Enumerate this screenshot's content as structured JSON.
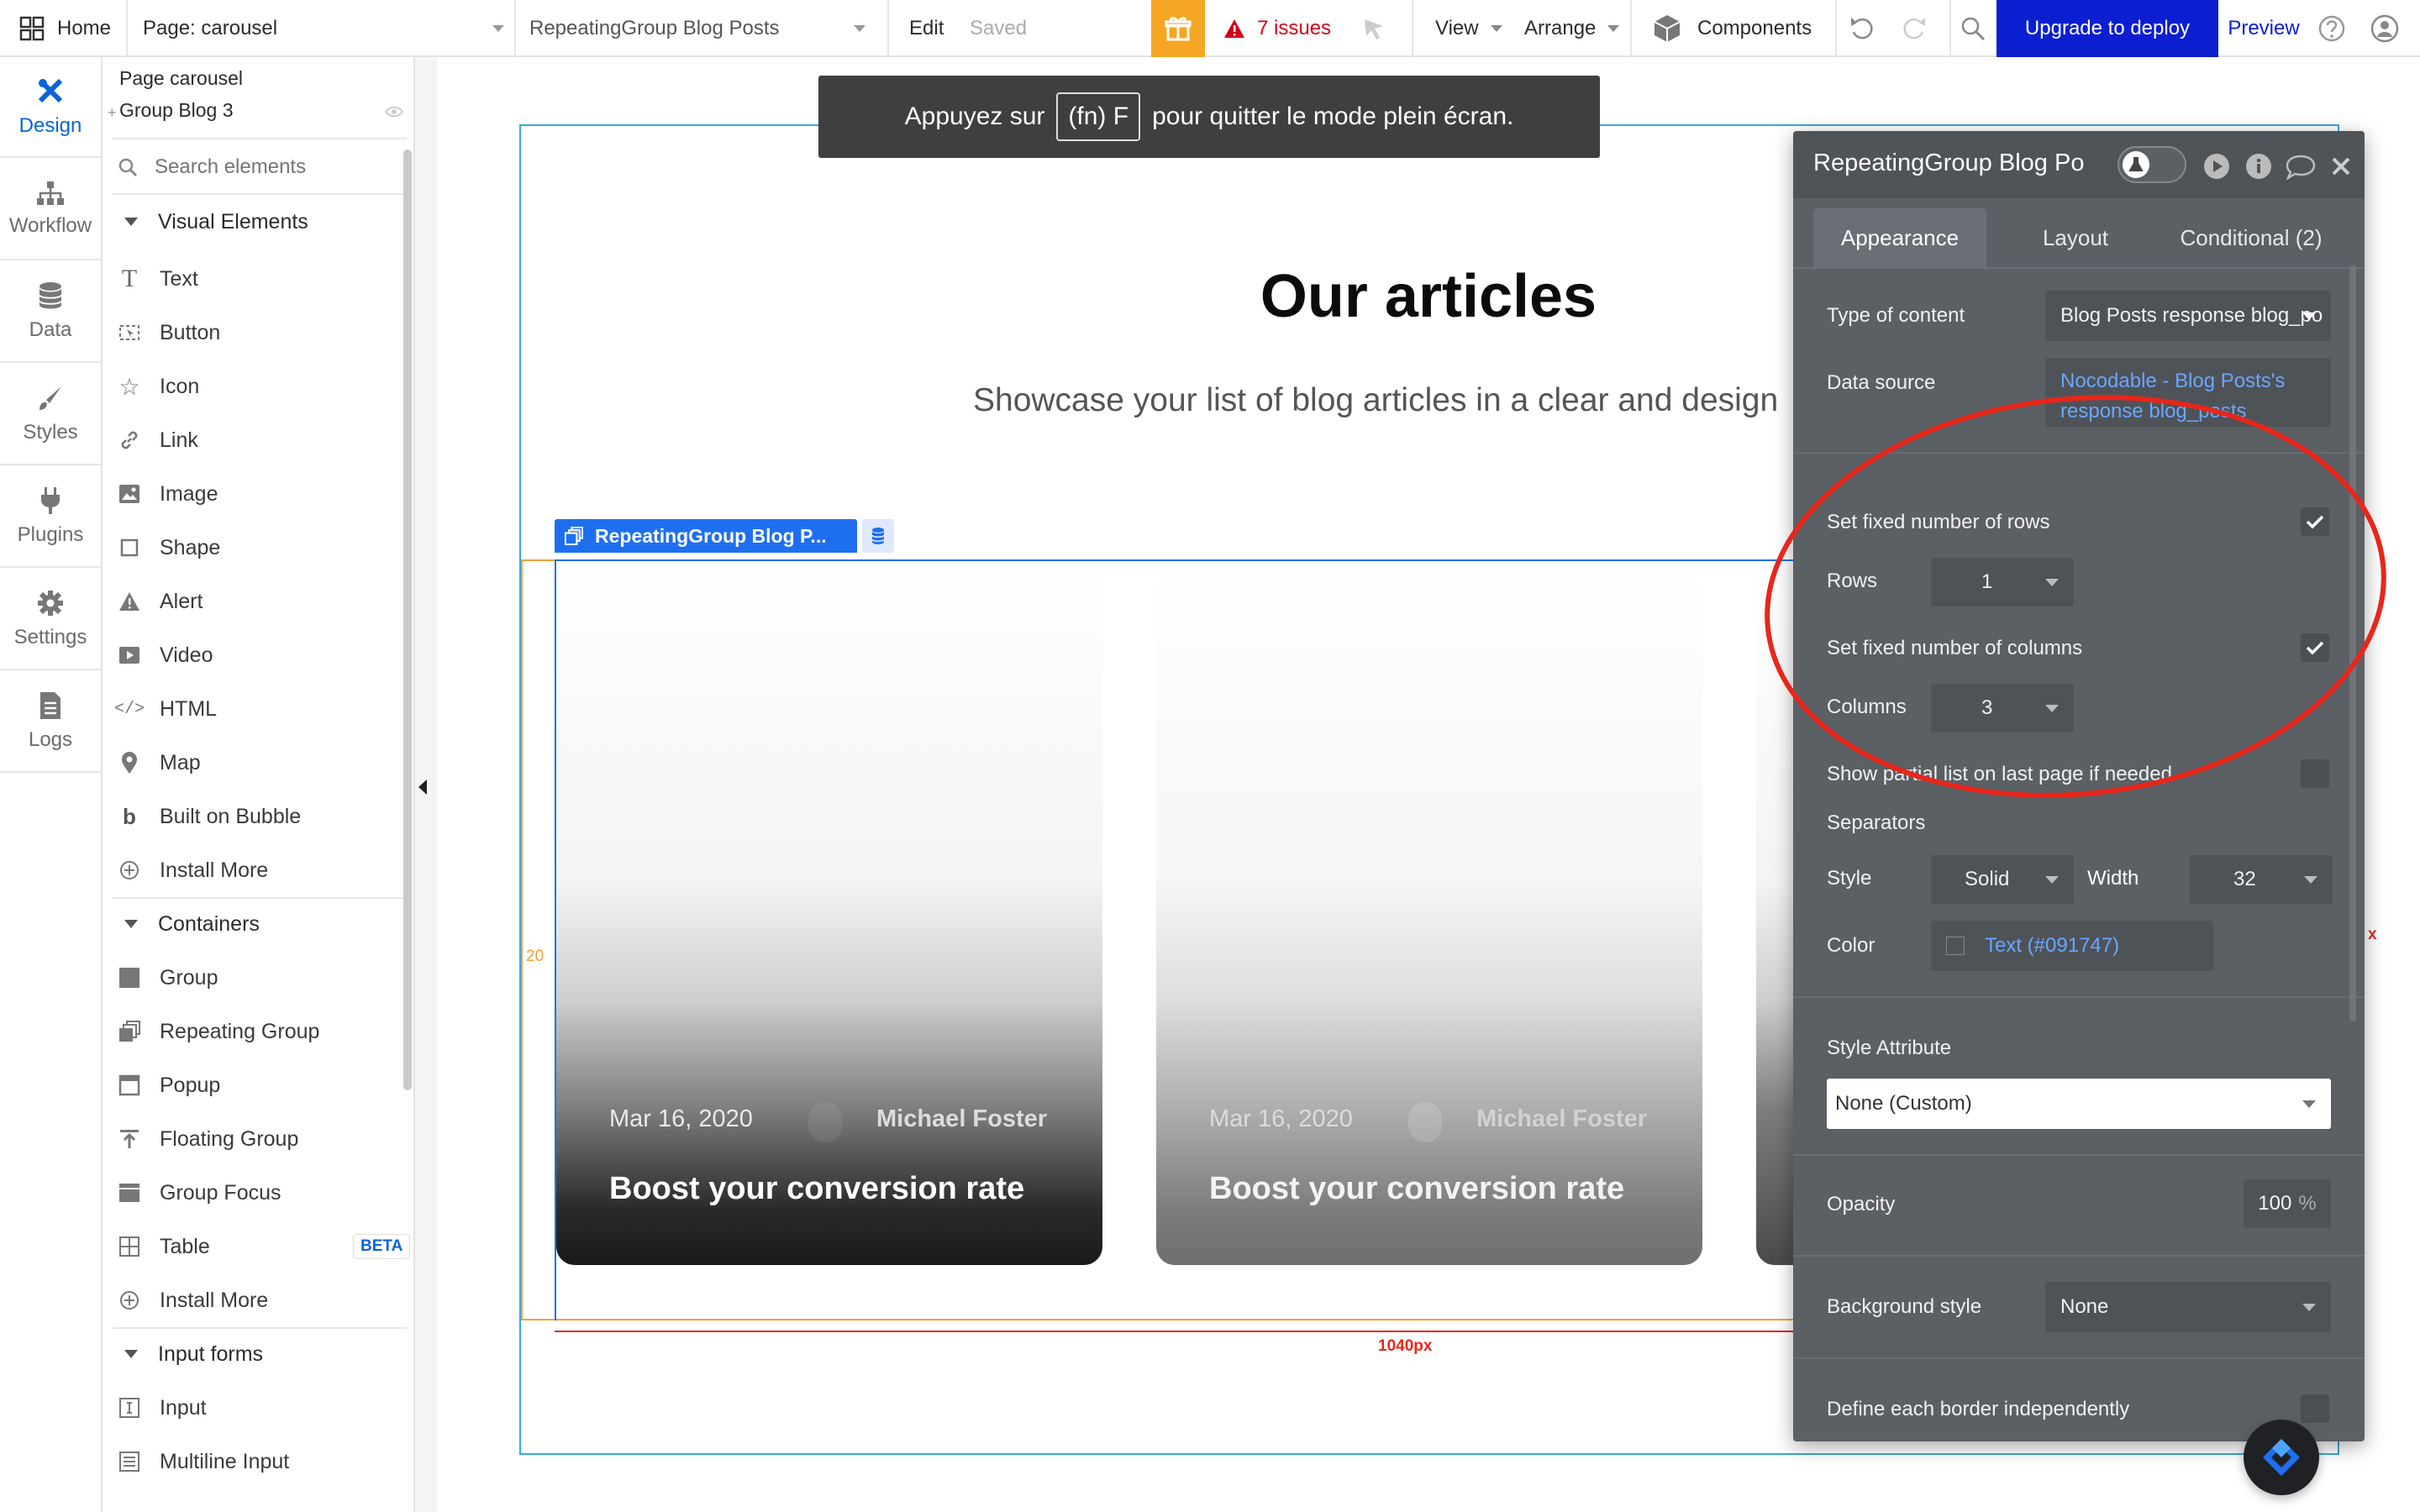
{
  "topbar": {
    "home_label": "Home",
    "page_label": "Page: carousel",
    "element_label": "RepeatingGroup Blog Posts",
    "edit_label": "Edit",
    "saved_label": "Saved",
    "issues_label": "7 issues",
    "view_label": "View",
    "arrange_label": "Arrange",
    "components_label": "Components",
    "upgrade_label": "Upgrade to deploy",
    "preview_label": "Preview",
    "accent_color": "#0b1fd1",
    "gift_color": "#f5a623"
  },
  "rail": {
    "items": [
      {
        "label": "Design",
        "icon": "design-icon"
      },
      {
        "label": "Workflow",
        "icon": "workflow-icon"
      },
      {
        "label": "Data",
        "icon": "data-icon"
      },
      {
        "label": "Styles",
        "icon": "brush-icon"
      },
      {
        "label": "Plugins",
        "icon": "plug-icon"
      },
      {
        "label": "Settings",
        "icon": "gear-icon"
      },
      {
        "label": "Logs",
        "icon": "logs-icon"
      }
    ]
  },
  "palette": {
    "tree_page": "Page carousel",
    "tree_group": "Group Blog 3",
    "search_placeholder": "Search elements",
    "visual_header": "Visual Elements",
    "visual_items": [
      "Text",
      "Button",
      "Icon",
      "Link",
      "Image",
      "Shape",
      "Alert",
      "Video",
      "HTML",
      "Map",
      "Built on Bubble",
      "Install More"
    ],
    "containers_header": "Containers",
    "container_items": [
      "Group",
      "Repeating Group",
      "Popup",
      "Floating Group",
      "Group Focus",
      "Table",
      "Install More"
    ],
    "beta_label": "BETA",
    "input_header": "Input forms",
    "input_items": [
      "Input",
      "Multiline Input"
    ]
  },
  "canvas": {
    "toast_prefix": "Appuyez sur",
    "toast_key": "(fn) F",
    "toast_suffix": "pour quitter le mode plein écran.",
    "heading": "Our articles",
    "subheading": "Showcase your list of blog articles in a clear and design",
    "rg_tag": "RepeatingGroup Blog P...",
    "margin_label": "20",
    "width_label": "1040px",
    "cards": [
      {
        "date": "Mar 16, 2020",
        "author": "Michael Foster",
        "title": "Boost your conversion rate"
      },
      {
        "date": "Mar 16, 2020",
        "author": "Michael Foster",
        "title": "Boost your conversion rate"
      }
    ]
  },
  "panel": {
    "title": "RepeatingGroup Blog Po",
    "tabs": [
      "Appearance",
      "Layout",
      "Conditional (2)"
    ],
    "type_of_content_label": "Type of content",
    "type_of_content_value": "Blog Posts response blog_po",
    "data_source_label": "Data source",
    "data_source_value": "Nocodable - Blog Posts's response blog_posts",
    "fixed_rows_label": "Set fixed number of rows",
    "rows_label": "Rows",
    "rows_value": "1",
    "fixed_cols_label": "Set fixed number of columns",
    "columns_label": "Columns",
    "columns_value": "3",
    "partial_label": "Show partial list on last page if needed",
    "separators_label": "Separators",
    "style_label": "Style",
    "style_value": "Solid",
    "width_label": "Width",
    "width_value": "32",
    "color_label": "Color",
    "color_value": "Text (#091747)",
    "style_attr_label": "Style Attribute",
    "style_attr_value": "None (Custom)",
    "opacity_label": "Opacity",
    "opacity_value": "100",
    "opacity_unit": "%",
    "bg_style_label": "Background style",
    "bg_style_value": "None",
    "border_label": "Define each border independently"
  },
  "annotation_color": "#e8261b"
}
